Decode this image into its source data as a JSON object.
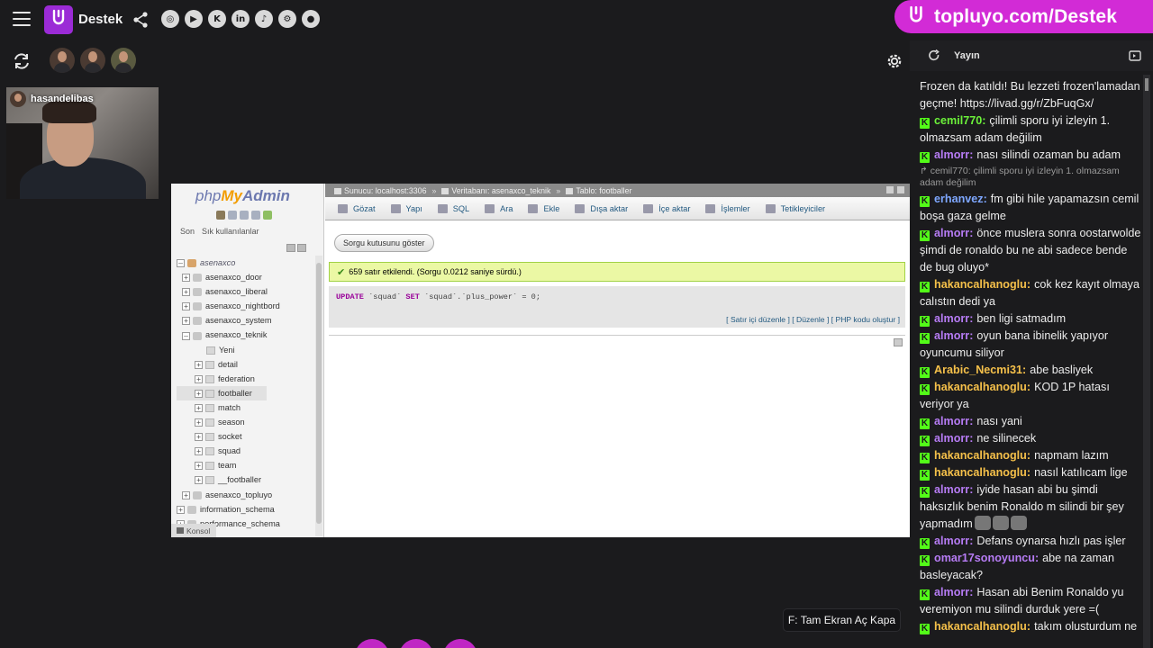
{
  "header": {
    "brand_name": "Destek",
    "socials": [
      {
        "name": "instagram-icon",
        "glyph": "◎"
      },
      {
        "name": "youtube-icon",
        "glyph": "▶"
      },
      {
        "name": "kick-icon",
        "glyph": "K"
      },
      {
        "name": "linkedin-icon",
        "glyph": "in"
      },
      {
        "name": "tiktok-icon",
        "glyph": "♪"
      },
      {
        "name": "steam-icon",
        "glyph": "⚙"
      },
      {
        "name": "github-icon",
        "glyph": "●"
      }
    ]
  },
  "banner": {
    "text": "topluyo.com/Destek",
    "color": "#d22bd6"
  },
  "webcam": {
    "username": "hasandelibas"
  },
  "pma": {
    "logo_php": "php",
    "logo_my": "My",
    "logo_admin": "Admin",
    "left_tabs": [
      "Son",
      "Sık kullanılanlar"
    ],
    "tree": [
      {
        "label": "asenaxco",
        "kind": "root",
        "toggle": "–"
      },
      {
        "label": "asenaxco_door",
        "kind": "db",
        "toggle": "+"
      },
      {
        "label": "asenaxco_liberal",
        "kind": "db",
        "toggle": "+"
      },
      {
        "label": "asenaxco_nightbord",
        "kind": "db",
        "toggle": "+"
      },
      {
        "label": "asenaxco_system",
        "kind": "db",
        "toggle": "+"
      },
      {
        "label": "asenaxco_teknik",
        "kind": "db",
        "toggle": "–"
      },
      {
        "label": "Yeni",
        "kind": "new"
      },
      {
        "label": "detail",
        "kind": "table",
        "toggle": "+"
      },
      {
        "label": "federation",
        "kind": "table",
        "toggle": "+"
      },
      {
        "label": "footballer",
        "kind": "table",
        "toggle": "+",
        "selected": true
      },
      {
        "label": "match",
        "kind": "table",
        "toggle": "+"
      },
      {
        "label": "season",
        "kind": "table",
        "toggle": "+"
      },
      {
        "label": "socket",
        "kind": "table",
        "toggle": "+"
      },
      {
        "label": "squad",
        "kind": "table",
        "toggle": "+"
      },
      {
        "label": "team",
        "kind": "table",
        "toggle": "+"
      },
      {
        "label": "__footballer",
        "kind": "table",
        "toggle": "+"
      },
      {
        "label": "asenaxco_topluyo",
        "kind": "db",
        "toggle": "+"
      },
      {
        "label": "information_schema",
        "kind": "topdb",
        "toggle": "+"
      },
      {
        "label": "performance_schema",
        "kind": "topdb",
        "toggle": "+"
      }
    ],
    "breadcrumb": [
      "Sunucu: localhost:3306",
      "Veritabanı: asenaxco_teknik",
      "Tablo: footballer"
    ],
    "menu": [
      "Gözat",
      "Yapı",
      "SQL",
      "Ara",
      "Ekle",
      "Dışa aktar",
      "İçe aktar",
      "İşlemler",
      "Tetikleyiciler"
    ],
    "show_query_button": "Sorgu kutusunu göster",
    "success_message": "659 satır etkilendi. (Sorgu 0.0212 saniye sürdü.)",
    "sql": {
      "kw1": "UPDATE",
      "part1": "`squad`",
      "kw2": "SET",
      "part2": "`squad`.`plus_power` = 0;"
    },
    "sql_links": "[ Satır içi düzenle ] [ Düzenle ] [ PHP kodu oluştur ]",
    "console_label": "Konsol"
  },
  "tooltip": "F: Tam Ekran Aç Kapa",
  "chat": {
    "title": "Yayın",
    "messages": [
      {
        "text": "Frozen da katıldı! Bu lezzeti frozen'lamadan geçme! https://livad.gg/r/ZbFuqGx/"
      },
      {
        "user": "cemil770:",
        "color": "#6cf23a",
        "text": "çilimli sporu iyi izleyin 1. olmazsam adam değilim"
      },
      {
        "user": "almorr:",
        "color": "#b77cf5",
        "text": "nası silindi ozaman bu adam",
        "reply": "↱ cemil770: çilimli sporu iyi izleyin 1. olmazsam adam değilim"
      },
      {
        "user": "erhanvez:",
        "color": "#7ea7ff",
        "text": "fm gibi hile yapamazsın cemil boşa gaza gelme"
      },
      {
        "user": "almorr:",
        "color": "#b77cf5",
        "text": "önce muslera sonra oostarwolde şimdi de ronaldo bu ne abi sadece bende de bug oluyo*"
      },
      {
        "user": "hakancalhanoglu:",
        "color": "#f5c04a",
        "text": "cok kez kayıt olmaya calıstın dedi ya"
      },
      {
        "user": "almorr:",
        "color": "#b77cf5",
        "text": "ben ligi satmadım"
      },
      {
        "user": "almorr:",
        "color": "#b77cf5",
        "text": "oyun bana ibinelik yapıyor oyuncumu siliyor"
      },
      {
        "user": "Arabic_Necmi31:",
        "color": "#f5c04a",
        "text": "abe basliyek"
      },
      {
        "user": "hakancalhanoglu:",
        "color": "#f5c04a",
        "text": "KOD 1P hatası veriyor ya"
      },
      {
        "user": "almorr:",
        "color": "#b77cf5",
        "text": "nası yani"
      },
      {
        "user": "almorr:",
        "color": "#b77cf5",
        "text": "ne silinecek"
      },
      {
        "user": "hakancalhanoglu:",
        "color": "#f5c04a",
        "text": "napmam lazım"
      },
      {
        "user": "hakancalhanoglu:",
        "color": "#f5c04a",
        "text": "nasıl katılıcam lige"
      },
      {
        "user": "almorr:",
        "color": "#b77cf5",
        "text": "iyide hasan abi bu şimdi haksızlık benim Ronaldo m silindi bir şey yapmadım",
        "emotes": 3
      },
      {
        "user": "almorr:",
        "color": "#b77cf5",
        "text": "Defans oynarsa hızlı pas işler"
      },
      {
        "user": "omar17sonoyuncu:",
        "color": "#b77cf5",
        "text": "abe na zaman basleyacak?"
      },
      {
        "user": "almorr:",
        "color": "#b77cf5",
        "text": "Hasan abi Benim Ronaldo yu veremiyon mu silindi durduk yere =("
      },
      {
        "user": "hakancalhanoglu:",
        "color": "#f5c04a",
        "text": "takım olusturdum ne"
      }
    ]
  }
}
